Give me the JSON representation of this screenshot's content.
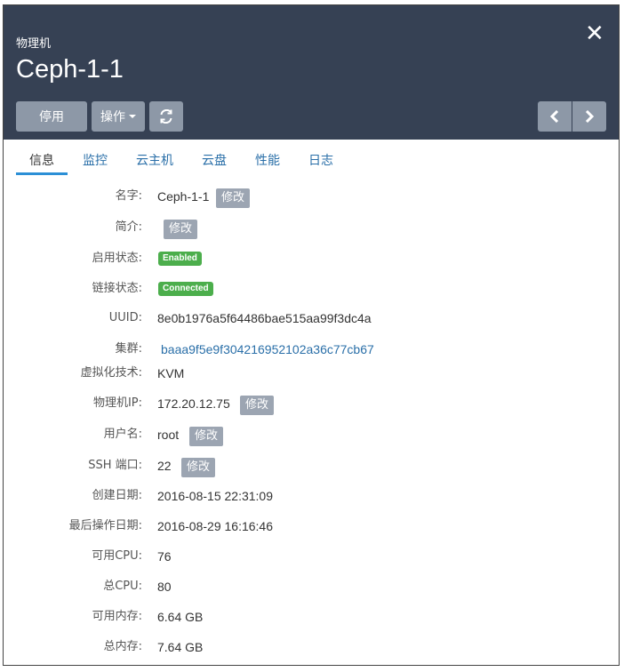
{
  "header": {
    "subtitle": "物理机",
    "title": "Ceph-1-1",
    "close_icon": "close-icon",
    "buttons": {
      "disable": "停用",
      "operations": "操作",
      "refresh_icon": "refresh-icon",
      "prev_icon": "chevron-left-icon",
      "next_icon": "chevron-right-icon"
    }
  },
  "tabs": [
    "信息",
    "监控",
    "云主机",
    "云盘",
    "性能",
    "日志"
  ],
  "active_tab": "信息",
  "edit_label": "修改",
  "fields": {
    "name": {
      "label": "名字:",
      "value": "Ceph-1-1"
    },
    "description": {
      "label": "简介:",
      "value": ""
    },
    "enable_state": {
      "label": "启用状态:",
      "value": "Enabled"
    },
    "connection_state": {
      "label": "链接状态:",
      "value": "Connected"
    },
    "uuid": {
      "label": "UUID:",
      "value": "8e0b1976a5f64486bae515aa99f3dc4a"
    },
    "cluster": {
      "label": "集群:",
      "value": "baaa9f5e9f304216952102a36c77cb67"
    },
    "hypervisor": {
      "label": "虚拟化技术:",
      "value": "KVM"
    },
    "host_ip": {
      "label": "物理机IP:",
      "value": "172.20.12.75"
    },
    "username": {
      "label": "用户名:",
      "value": "root"
    },
    "ssh_port": {
      "label": "SSH 端口:",
      "value": "22"
    },
    "created": {
      "label": "创建日期:",
      "value": "2016-08-15 22:31:09"
    },
    "last_op": {
      "label": "最后操作日期:",
      "value": "2016-08-29 16:16:46"
    },
    "avail_cpu": {
      "label": "可用CPU:",
      "value": "76"
    },
    "total_cpu": {
      "label": "总CPU:",
      "value": "80"
    },
    "avail_mem": {
      "label": "可用内存:",
      "value": "6.64 GB"
    },
    "total_mem": {
      "label": "总内存:",
      "value": "7.64 GB"
    }
  },
  "colors": {
    "header_bg": "#364154",
    "button_bg": "#8d98a7",
    "link": "#2a6fa8",
    "badge_green": "#4cae4c",
    "tab_underline": "#2b8fd6"
  }
}
